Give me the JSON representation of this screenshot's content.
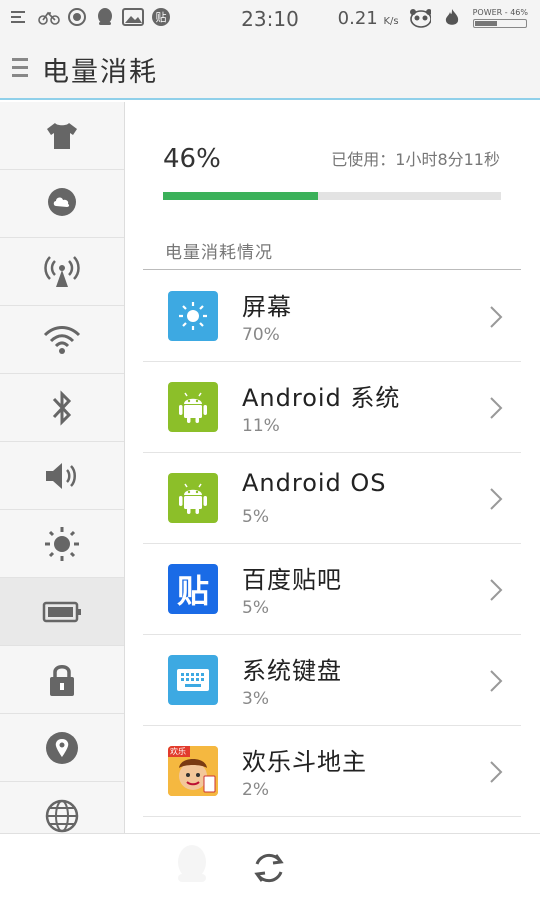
{
  "status_bar": {
    "time": "23:10",
    "net_speed": "0.21",
    "net_unit": "K/s",
    "power_label": "POWER - 46%",
    "power_level": 0.46,
    "icons": [
      "notification-menu-icon",
      "bike-icon",
      "camera-lens-icon",
      "qq-icon",
      "image-icon",
      "tieba-icon",
      "panda-icon",
      "flame-icon"
    ]
  },
  "header": {
    "title": "电量消耗",
    "menu_icon": "menu-icon"
  },
  "sidebar": {
    "items": [
      {
        "icon": "tshirt-icon"
      },
      {
        "icon": "cloud-icon"
      },
      {
        "icon": "antenna-icon"
      },
      {
        "icon": "wifi-icon"
      },
      {
        "icon": "bluetooth-icon"
      },
      {
        "icon": "volume-icon"
      },
      {
        "icon": "brightness-icon"
      },
      {
        "icon": "battery-icon",
        "active": true
      },
      {
        "icon": "lock-icon"
      },
      {
        "icon": "location-icon"
      },
      {
        "icon": "globe-icon"
      }
    ]
  },
  "battery": {
    "percent_text": "46%",
    "percent": 0.46,
    "used_text": "已使用：1小时8分11秒",
    "bar_color": "#3bb15a"
  },
  "section_title": "电量消耗情况",
  "apps": [
    {
      "name": "屏幕",
      "percent": "70%",
      "icon": "screen-brightness-icon",
      "icon_bg": "#3da9e2"
    },
    {
      "name": "Android 系统",
      "percent": "11%",
      "icon": "android-icon",
      "icon_bg": "#8cbf29"
    },
    {
      "name": "Android OS",
      "percent": "5%",
      "icon": "android-icon",
      "icon_bg": "#8cbf29"
    },
    {
      "name": "百度贴吧",
      "percent": "5%",
      "icon": "tieba-app-icon",
      "icon_bg": "#1a6be6",
      "icon_text": "贴"
    },
    {
      "name": "系统键盘",
      "percent": "3%",
      "icon": "keyboard-icon",
      "icon_bg": "#3da9e2"
    },
    {
      "name": "欢乐斗地主",
      "percent": "2%",
      "icon": "doudizhu-game-icon",
      "icon_bg": "#f2a53a",
      "icon_badge": "欢乐"
    }
  ],
  "bottom_bar": {
    "refresh_icon": "refresh-icon"
  }
}
